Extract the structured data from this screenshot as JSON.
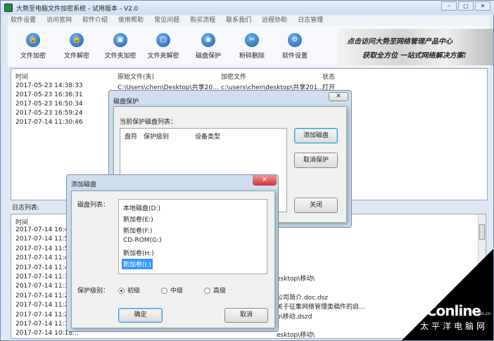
{
  "window": {
    "title": "大势至电脑文件加密系统 - 试用版本 - V2.0",
    "min": "–",
    "max": "□",
    "close": "✕"
  },
  "menu": [
    "软件设置",
    "访问官网",
    "软件介绍",
    "使用帮助",
    "常见问题",
    "购买流程",
    "联系我们",
    "远程协助",
    "日志管理"
  ],
  "toolbar": [
    {
      "label": "文件加密",
      "icon": "🔒"
    },
    {
      "label": "文件解密",
      "icon": "🔓"
    },
    {
      "label": "文件夹加密",
      "icon": "▣"
    },
    {
      "label": "文件夹解密",
      "icon": "▢"
    },
    {
      "label": "磁盘保护",
      "icon": "◉"
    },
    {
      "label": "粉碎删除",
      "icon": "✂"
    },
    {
      "label": "软件设置",
      "icon": "⚙"
    }
  ],
  "banner": {
    "line1": "点击访问大势至网络管理产品中心",
    "line2": "获取全方位 一站式网络解决方案!"
  },
  "file_list": {
    "headers": [
      "时间",
      "原始文件(夹)",
      "加密文件",
      "状态"
    ],
    "rows": [
      [
        "2017-05-23 14:38:33",
        "C:\\Users\\chen\\Desktop\\共享20...",
        "c:\\users\\chen\\desktop\\共享201...",
        "打开"
      ],
      [
        "2017-05-23 16:36:31",
        "",
        "",
        ""
      ],
      [
        "2017-05-23 16:50:34",
        "",
        "",
        ""
      ],
      [
        "2017-05-23 16:59:24",
        "",
        "",
        ""
      ],
      [
        "2017-07-14 11:30:46",
        "",
        "",
        ""
      ]
    ]
  },
  "log": {
    "label": "日志列表:",
    "header": "时间",
    "times": [
      "2017-07-14 16:47",
      "2017-07-14 11:51",
      "2017-07-14 11:50",
      "2017-07-14 11:48",
      "2017-07-14 11:47",
      "2017-07-14 11:30",
      "2017-07-14 11:30",
      "2017-07-14 11:26",
      "2017-07-14 11:26",
      "2017-07-14 11:25",
      "2017-07-14 11:13",
      "2017-07-14 10:18..."
    ],
    "fragments": [
      "",
      "",
      "",
      "",
      "",
      "esktop\\移动\\",
      "",
      "公司简介.doc.dsz",
      "关于征集网络管理类稿件的启...",
      "p\\移动.dszd",
      "",
      "esktop\\移动\\"
    ]
  },
  "disk_protect": {
    "title": "磁盘保护",
    "list_label": "当前保护磁盘列表：",
    "headers": [
      "盘符",
      "保护级别",
      "设备类型"
    ],
    "add": "添加磁盘",
    "cancel": "取消保护",
    "close": "关闭",
    "close_icon": "✕"
  },
  "add_disk": {
    "title": "添加磁盘",
    "close_icon": "✕",
    "list_label": "磁盘列表：",
    "disks": [
      "本地磁盘(D:)",
      "新加卷(E:)",
      "新加卷(F:)",
      "CD-ROM(G:)",
      "新加卷(H:)",
      "新加卷(I:)"
    ],
    "selected_index": 5,
    "level_label": "保护级别：",
    "levels": [
      "初级",
      "中级",
      "高级"
    ],
    "selected_level": "初级",
    "ok": "确定",
    "cancel": "取消"
  },
  "watermark": {
    "brand": "PConline",
    "domain": ".com.cn",
    "cn": "太平洋电脑网"
  }
}
